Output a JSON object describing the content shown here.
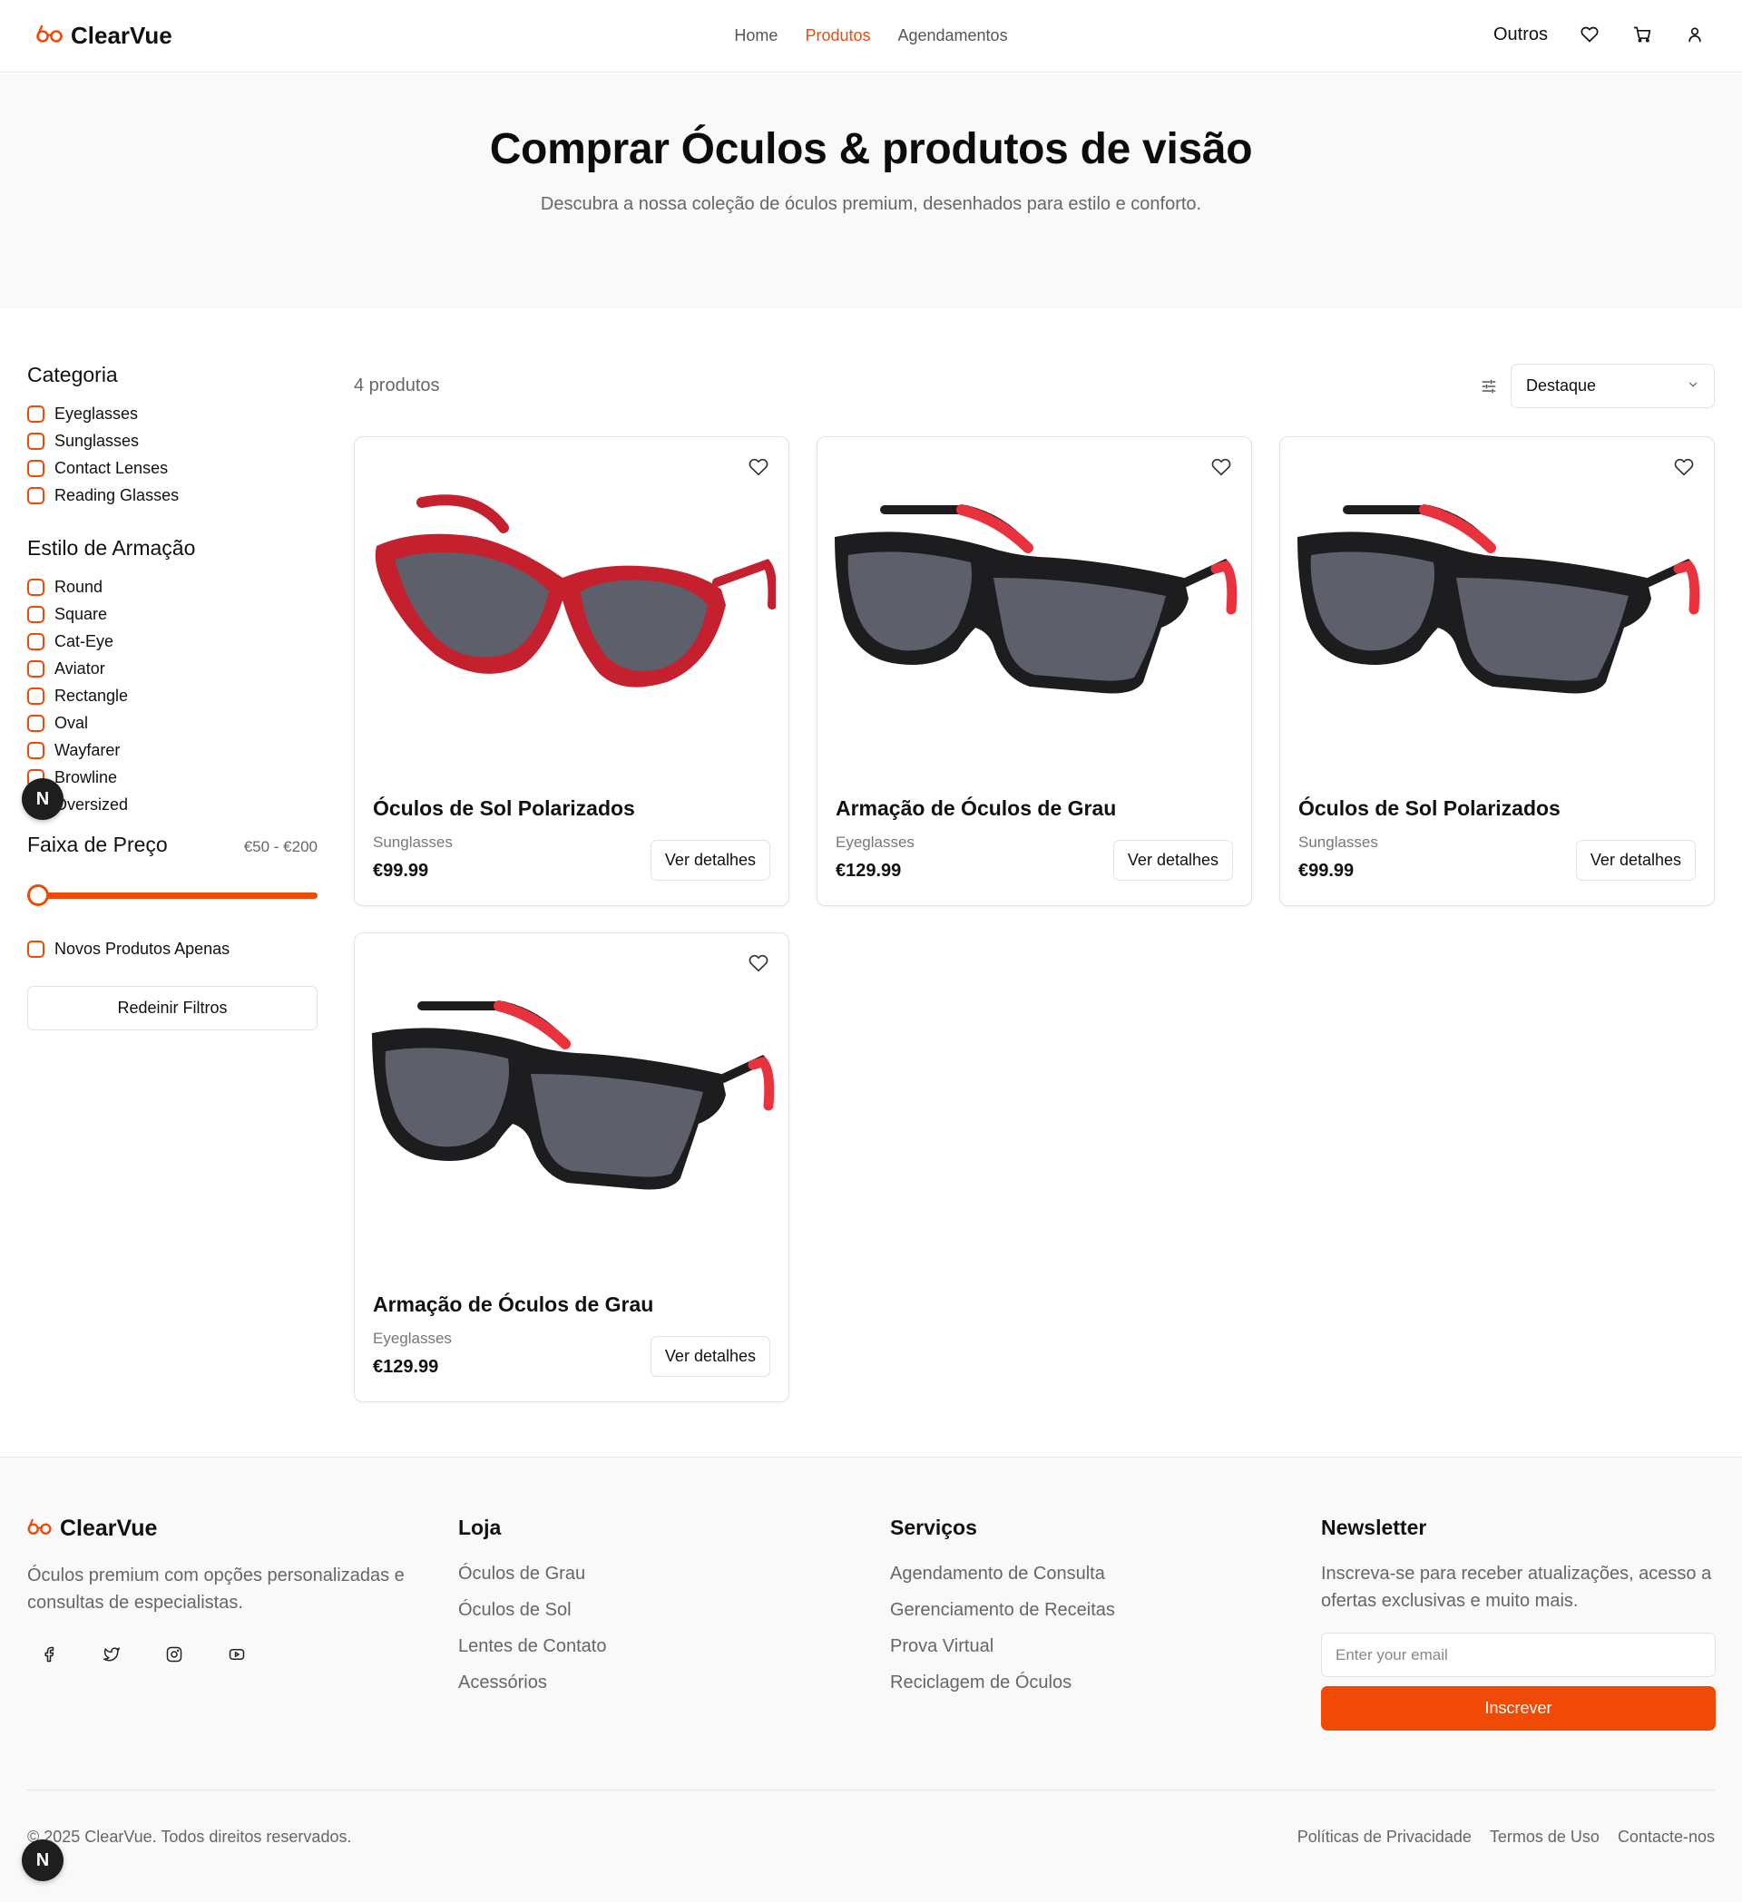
{
  "colors": {
    "accent": "#f04a06",
    "text": "#111111",
    "muted": "#666666",
    "hero_bg": "#f9f9f9"
  },
  "nav": {
    "brand": "ClearVue",
    "links": [
      "Home",
      "Produtos",
      "Agendamentos"
    ],
    "active_link": "Produtos",
    "right_label": "Outros",
    "icons": [
      "heart-icon",
      "cart-icon",
      "user-icon"
    ]
  },
  "hero": {
    "title": "Comprar Óculos & produtos de visão",
    "subtitle": "Descubra a nossa coleção de óculos premium, desenhados para estilo e conforto."
  },
  "filters": {
    "category_title": "Categoria",
    "categories": [
      "Eyeglasses",
      "Sunglasses",
      "Contact Lenses",
      "Reading Glasses"
    ],
    "frame_title": "Estilo de Armação",
    "frames": [
      "Round",
      "Square",
      "Cat-Eye",
      "Aviator",
      "Rectangle",
      "Oval",
      "Wayfarer",
      "Browline",
      "Oversized"
    ],
    "price_title": "Faixa de Preço",
    "price_range": "€50 - €200",
    "new_only": "Novos Produtos Apenas",
    "reset": "Redeinir Filtros"
  },
  "listing": {
    "count": "4 produtos",
    "sort_value": "Destaque",
    "products": [
      {
        "name": "Óculos de Sol Polarizados",
        "category": "Sunglasses",
        "price": "€99.99",
        "button": "Ver detalhes",
        "frame_color": "#c4202e",
        "style": "cat-eye"
      },
      {
        "name": "Armação de Óculos de Grau",
        "category": "Eyeglasses",
        "price": "€129.99",
        "button": "Ver detalhes",
        "frame_color": "#1d1d1f",
        "style": "rectangle"
      },
      {
        "name": "Óculos de Sol Polarizados",
        "category": "Sunglasses",
        "price": "€99.99",
        "button": "Ver detalhes",
        "frame_color": "#1d1d1f",
        "style": "rectangle"
      },
      {
        "name": "Armação de Óculos de Grau",
        "category": "Eyeglasses",
        "price": "€129.99",
        "button": "Ver detalhes",
        "frame_color": "#1d1d1f",
        "style": "rectangle"
      }
    ]
  },
  "footer": {
    "brand": "ClearVue",
    "description": "Óculos premium com opções personalizadas e consultas de especialistas.",
    "socials": [
      "facebook-icon",
      "twitter-icon",
      "instagram-icon",
      "youtube-icon"
    ],
    "shop_title": "Loja",
    "shop_links": [
      "Óculos de Grau",
      "Óculos de Sol",
      "Lentes de Contato",
      "Acessórios"
    ],
    "services_title": "Serviços",
    "services_links": [
      "Agendamento de Consulta",
      "Gerenciamento de Receitas",
      "Prova Virtual",
      "Reciclagem de Óculos"
    ],
    "newsletter_title": "Newsletter",
    "newsletter_text": "Inscreva-se para receber atualizações, acesso a ofertas exclusivas e muito mais.",
    "email_placeholder": "Enter your email",
    "subscribe": "Inscrever",
    "copyright": "© 2025 ClearVue. Todos direitos reservados.",
    "legal": [
      "Políticas de Privacidade",
      "Termos de Uso",
      "Contacte-nos"
    ]
  },
  "badge": "N"
}
